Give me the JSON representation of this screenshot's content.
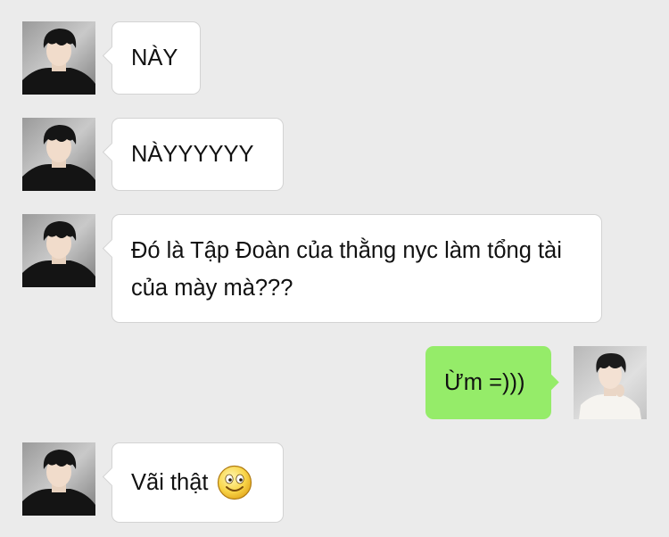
{
  "messages": [
    {
      "from": "contact",
      "text": "NÀY"
    },
    {
      "from": "contact",
      "text": "NÀYYYYYY"
    },
    {
      "from": "contact",
      "text": "Đó là Tập Đoàn của thằng nyc làm tổng tài của mày mà???"
    },
    {
      "from": "me",
      "text": "Ừm =)))"
    },
    {
      "from": "contact",
      "text": "Vãi thật",
      "emoji": "smiley-emoji"
    }
  ],
  "colors": {
    "background": "#ebebeb",
    "incoming_bubble": "#ffffff",
    "outgoing_bubble": "#95ec69"
  },
  "icons": {
    "contact_avatar": "contact-avatar",
    "my_avatar": "my-avatar",
    "emoji": "smiley-emoji"
  }
}
